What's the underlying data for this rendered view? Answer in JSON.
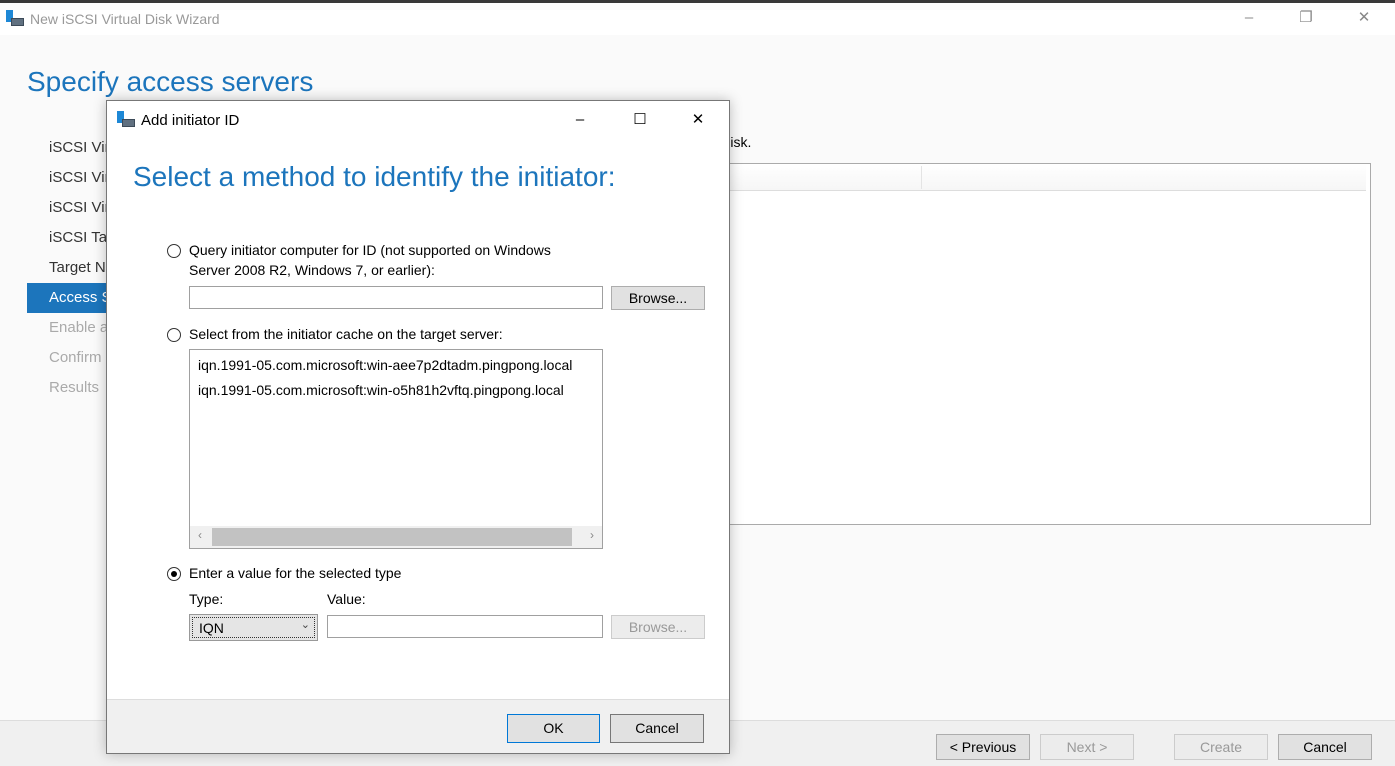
{
  "window": {
    "title": "New iSCSI Virtual Disk Wizard",
    "minimize": "–",
    "restore": "❐",
    "close": "✕"
  },
  "page_title": "Specify access servers",
  "nav": [
    {
      "label": "iSCSI Vir",
      "state": "normal"
    },
    {
      "label": "iSCSI Vir",
      "state": "normal"
    },
    {
      "label": "iSCSI Vir",
      "state": "normal"
    },
    {
      "label": "iSCSI Tar",
      "state": "normal"
    },
    {
      "label": "Target N",
      "state": "normal"
    },
    {
      "label": "Access S",
      "state": "selected"
    },
    {
      "label": "Enable a",
      "state": "disabled"
    },
    {
      "label": "Confirm",
      "state": "disabled"
    },
    {
      "label": "Results",
      "state": "disabled"
    }
  ],
  "description_fragment": "ual disk.",
  "footer": {
    "previous": "< Previous",
    "next": "Next >",
    "create": "Create",
    "cancel": "Cancel"
  },
  "dialog": {
    "title": "Add initiator ID",
    "minimize": "–",
    "maximize": "☐",
    "close": "✕",
    "heading": "Select a method to identify the initiator:",
    "option_query": "Query initiator computer for ID (not supported on Windows",
    "option_query_line2": "Server 2008 R2, Windows 7, or earlier):",
    "query_input": "",
    "browse": "Browse...",
    "option_cache": "Select from the initiator cache on the target server:",
    "cache": [
      "iqn.1991-05.com.microsoft:win-aee7p2dtadm.pingpong.local",
      "iqn.1991-05.com.microsoft:win-o5h81h2vftq.pingpong.local"
    ],
    "option_enter": "Enter a value for the selected type",
    "selected_option": "enter",
    "type_label": "Type:",
    "type_value": "IQN",
    "value_label": "Value:",
    "value_input": "",
    "browse2": "Browse...",
    "ok": "OK",
    "cancel": "Cancel"
  },
  "colors": {
    "accent": "#1c75bc"
  }
}
